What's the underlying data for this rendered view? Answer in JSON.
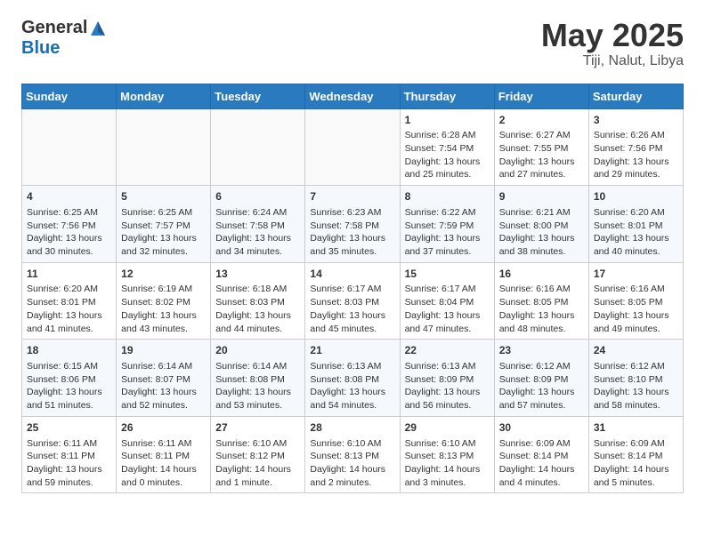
{
  "header": {
    "logo_general": "General",
    "logo_blue": "Blue",
    "month_year": "May 2025",
    "location": "Tiji, Nalut, Libya"
  },
  "weekdays": [
    "Sunday",
    "Monday",
    "Tuesday",
    "Wednesday",
    "Thursday",
    "Friday",
    "Saturday"
  ],
  "weeks": [
    [
      {
        "day": "",
        "content": ""
      },
      {
        "day": "",
        "content": ""
      },
      {
        "day": "",
        "content": ""
      },
      {
        "day": "",
        "content": ""
      },
      {
        "day": "1",
        "content": "Sunrise: 6:28 AM\nSunset: 7:54 PM\nDaylight: 13 hours\nand 25 minutes."
      },
      {
        "day": "2",
        "content": "Sunrise: 6:27 AM\nSunset: 7:55 PM\nDaylight: 13 hours\nand 27 minutes."
      },
      {
        "day": "3",
        "content": "Sunrise: 6:26 AM\nSunset: 7:56 PM\nDaylight: 13 hours\nand 29 minutes."
      }
    ],
    [
      {
        "day": "4",
        "content": "Sunrise: 6:25 AM\nSunset: 7:56 PM\nDaylight: 13 hours\nand 30 minutes."
      },
      {
        "day": "5",
        "content": "Sunrise: 6:25 AM\nSunset: 7:57 PM\nDaylight: 13 hours\nand 32 minutes."
      },
      {
        "day": "6",
        "content": "Sunrise: 6:24 AM\nSunset: 7:58 PM\nDaylight: 13 hours\nand 34 minutes."
      },
      {
        "day": "7",
        "content": "Sunrise: 6:23 AM\nSunset: 7:58 PM\nDaylight: 13 hours\nand 35 minutes."
      },
      {
        "day": "8",
        "content": "Sunrise: 6:22 AM\nSunset: 7:59 PM\nDaylight: 13 hours\nand 37 minutes."
      },
      {
        "day": "9",
        "content": "Sunrise: 6:21 AM\nSunset: 8:00 PM\nDaylight: 13 hours\nand 38 minutes."
      },
      {
        "day": "10",
        "content": "Sunrise: 6:20 AM\nSunset: 8:01 PM\nDaylight: 13 hours\nand 40 minutes."
      }
    ],
    [
      {
        "day": "11",
        "content": "Sunrise: 6:20 AM\nSunset: 8:01 PM\nDaylight: 13 hours\nand 41 minutes."
      },
      {
        "day": "12",
        "content": "Sunrise: 6:19 AM\nSunset: 8:02 PM\nDaylight: 13 hours\nand 43 minutes."
      },
      {
        "day": "13",
        "content": "Sunrise: 6:18 AM\nSunset: 8:03 PM\nDaylight: 13 hours\nand 44 minutes."
      },
      {
        "day": "14",
        "content": "Sunrise: 6:17 AM\nSunset: 8:03 PM\nDaylight: 13 hours\nand 45 minutes."
      },
      {
        "day": "15",
        "content": "Sunrise: 6:17 AM\nSunset: 8:04 PM\nDaylight: 13 hours\nand 47 minutes."
      },
      {
        "day": "16",
        "content": "Sunrise: 6:16 AM\nSunset: 8:05 PM\nDaylight: 13 hours\nand 48 minutes."
      },
      {
        "day": "17",
        "content": "Sunrise: 6:16 AM\nSunset: 8:05 PM\nDaylight: 13 hours\nand 49 minutes."
      }
    ],
    [
      {
        "day": "18",
        "content": "Sunrise: 6:15 AM\nSunset: 8:06 PM\nDaylight: 13 hours\nand 51 minutes."
      },
      {
        "day": "19",
        "content": "Sunrise: 6:14 AM\nSunset: 8:07 PM\nDaylight: 13 hours\nand 52 minutes."
      },
      {
        "day": "20",
        "content": "Sunrise: 6:14 AM\nSunset: 8:08 PM\nDaylight: 13 hours\nand 53 minutes."
      },
      {
        "day": "21",
        "content": "Sunrise: 6:13 AM\nSunset: 8:08 PM\nDaylight: 13 hours\nand 54 minutes."
      },
      {
        "day": "22",
        "content": "Sunrise: 6:13 AM\nSunset: 8:09 PM\nDaylight: 13 hours\nand 56 minutes."
      },
      {
        "day": "23",
        "content": "Sunrise: 6:12 AM\nSunset: 8:09 PM\nDaylight: 13 hours\nand 57 minutes."
      },
      {
        "day": "24",
        "content": "Sunrise: 6:12 AM\nSunset: 8:10 PM\nDaylight: 13 hours\nand 58 minutes."
      }
    ],
    [
      {
        "day": "25",
        "content": "Sunrise: 6:11 AM\nSunset: 8:11 PM\nDaylight: 13 hours\nand 59 minutes."
      },
      {
        "day": "26",
        "content": "Sunrise: 6:11 AM\nSunset: 8:11 PM\nDaylight: 14 hours\nand 0 minutes."
      },
      {
        "day": "27",
        "content": "Sunrise: 6:10 AM\nSunset: 8:12 PM\nDaylight: 14 hours\nand 1 minute."
      },
      {
        "day": "28",
        "content": "Sunrise: 6:10 AM\nSunset: 8:13 PM\nDaylight: 14 hours\nand 2 minutes."
      },
      {
        "day": "29",
        "content": "Sunrise: 6:10 AM\nSunset: 8:13 PM\nDaylight: 14 hours\nand 3 minutes."
      },
      {
        "day": "30",
        "content": "Sunrise: 6:09 AM\nSunset: 8:14 PM\nDaylight: 14 hours\nand 4 minutes."
      },
      {
        "day": "31",
        "content": "Sunrise: 6:09 AM\nSunset: 8:14 PM\nDaylight: 14 hours\nand 5 minutes."
      }
    ]
  ]
}
